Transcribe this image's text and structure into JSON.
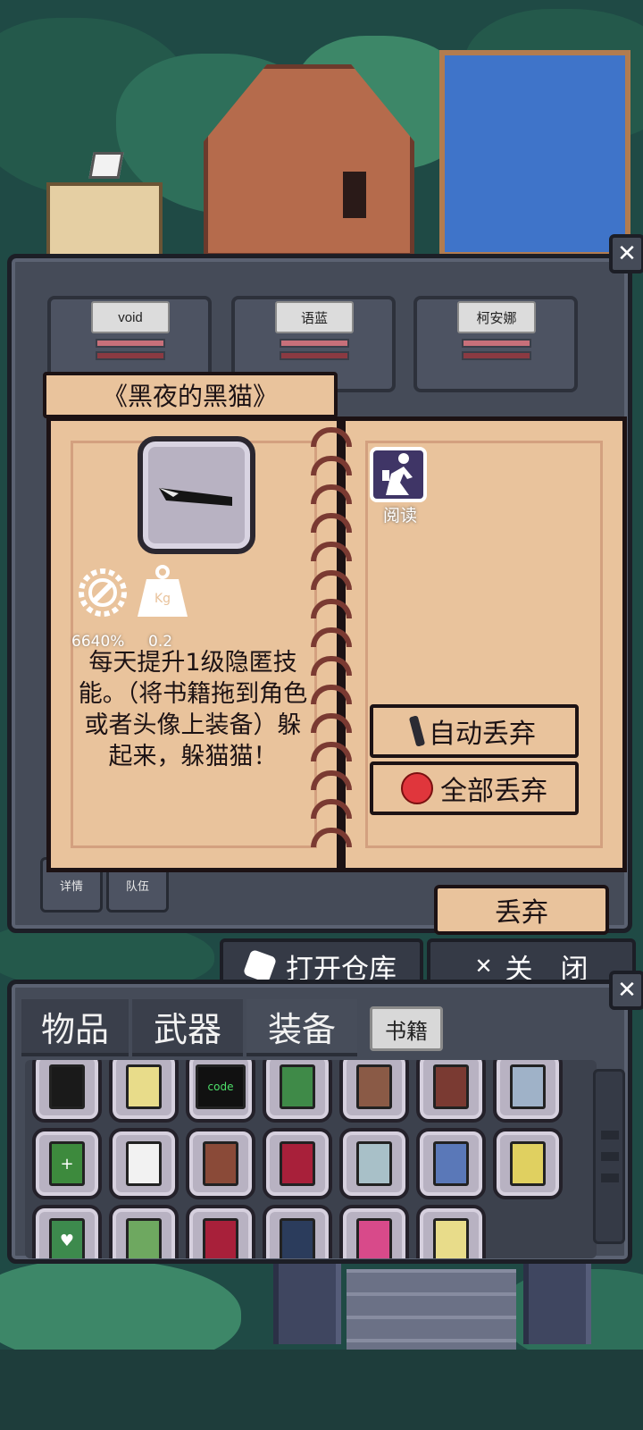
{
  "characters": [
    {
      "name": "void"
    },
    {
      "name": "语蓝"
    },
    {
      "name": "柯安娜"
    }
  ],
  "book": {
    "title": "《黑夜的黑猫》",
    "stat_value": "6640%",
    "weight_value": "0.2",
    "weight_unit": "Kg",
    "description": "每天提升1级隐匿技能。（将书籍拖到角色或者头像上装备）躲起来，躲猫猫！",
    "read_label": "阅读",
    "auto_drop_label": "自动丢弃",
    "drop_all_label": "全部丢弃"
  },
  "left_buttons": {
    "details": "详情",
    "team": "队伍"
  },
  "drop_label": "丢弃",
  "open_warehouse_label": "打开仓库",
  "close_label": "关　闭",
  "close_x": "✕",
  "inventory": {
    "tabs": [
      "物品",
      "武器",
      "装备",
      "书籍"
    ],
    "items": [
      {
        "icon": "knife-icon"
      },
      {
        "icon": "paper-brush-icon"
      },
      {
        "icon": "code-book-icon",
        "text": "code"
      },
      {
        "icon": "green-book-icon"
      },
      {
        "icon": "boot-card-icon"
      },
      {
        "icon": "book-stack-icon"
      },
      {
        "icon": "blue-book-icon"
      },
      {
        "icon": "green-cross-book-icon",
        "text": "+"
      },
      {
        "icon": "dotted-paper-icon"
      },
      {
        "icon": "red-gem-book-icon"
      },
      {
        "icon": "red-rune-book-icon"
      },
      {
        "icon": "scissors-book-icon"
      },
      {
        "icon": "glasses-book-icon"
      },
      {
        "icon": "hammer-book-icon"
      },
      {
        "icon": "heart-book-icon",
        "text": "♥"
      },
      {
        "icon": "camo-book-icon"
      },
      {
        "icon": "muscle-book-icon"
      },
      {
        "icon": "feather-book-icon"
      },
      {
        "icon": "magnifier-book-icon"
      },
      {
        "icon": "wrench-book-icon"
      }
    ]
  },
  "colors": {
    "panel": "#454b58",
    "parchment": "#e9c39c",
    "ink": "#1c1214",
    "read_icon_bg": "#3f3566"
  }
}
